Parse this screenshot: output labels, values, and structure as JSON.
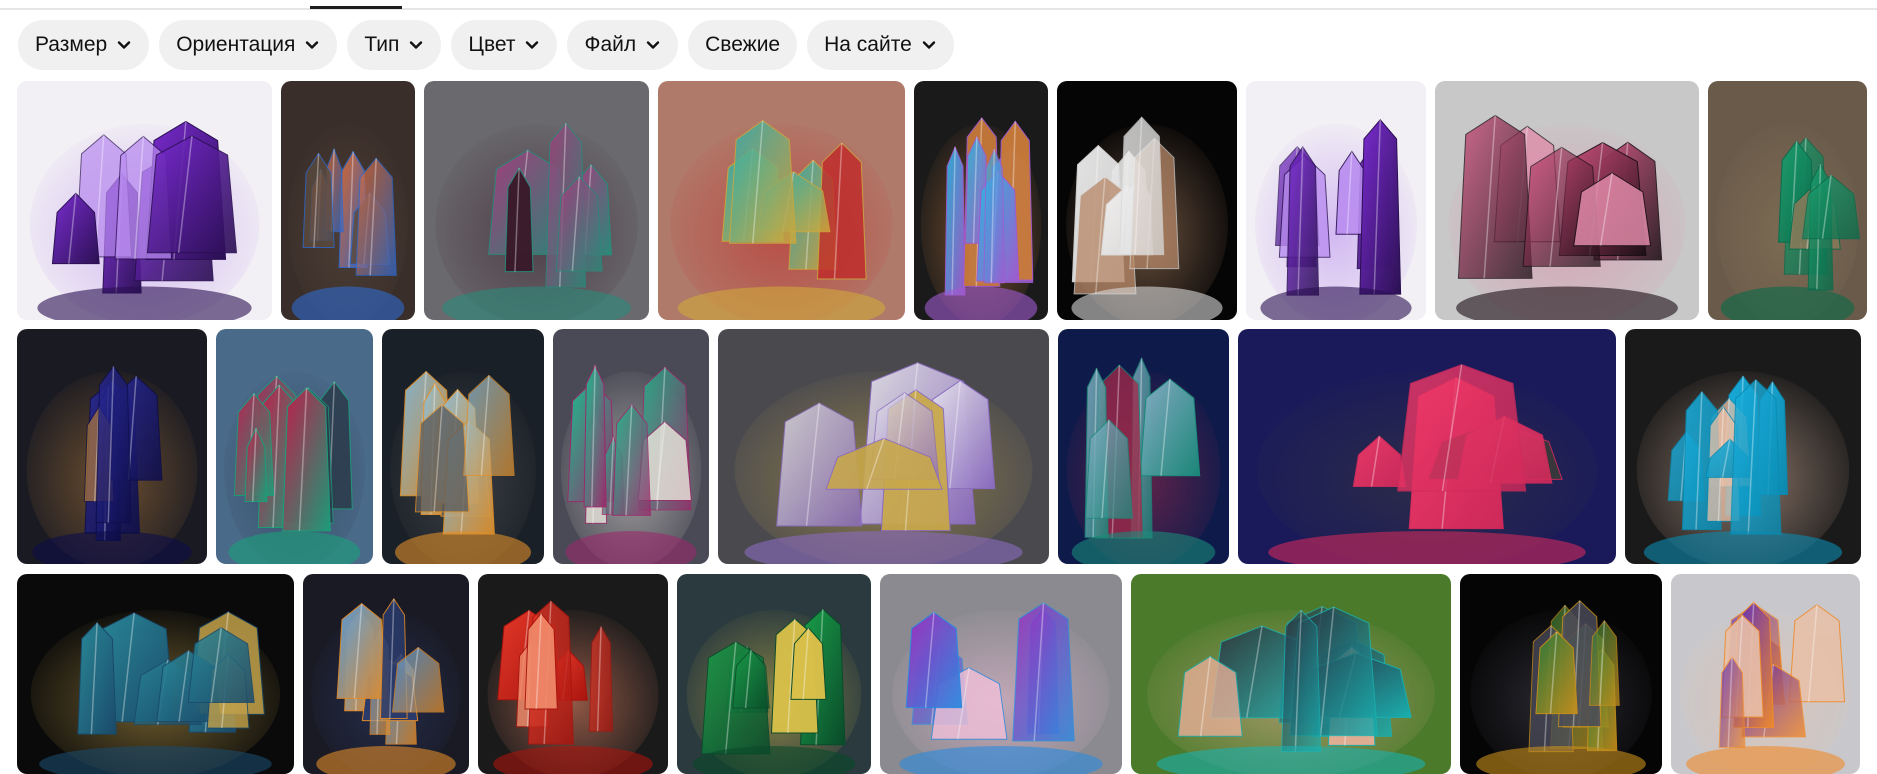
{
  "filters": {
    "size": "Размер",
    "orientation": "Ориентация",
    "type": "Тип",
    "color": "Цвет",
    "file": "Файл",
    "fresh": "Свежие",
    "on_site": "На сайте"
  },
  "gallery": {
    "rows": [
      [
        {
          "name": "purple-fluorite-cube",
          "bg": "#f2f0f4",
          "c1": "#7a2bd1",
          "c2": "#2a0f52",
          "c3": "#b98cf0"
        },
        {
          "name": "rainbow-crystal-on-rock",
          "bg": "#3a2e2a",
          "c1": "#e86a2a",
          "c2": "#2e6ad1",
          "c3": "#5a4a3e"
        },
        {
          "name": "multicolor-tourmaline-block",
          "bg": "#6a6a6e",
          "c1": "#a83a7e",
          "c2": "#2a8a7a",
          "c3": "#3a1a2a"
        },
        {
          "name": "watermelon-tourmaline-slab",
          "bg": "#b07a6a",
          "c1": "#2ab0b0",
          "c2": "#d0a83a",
          "c3": "#c02a2a"
        },
        {
          "name": "blue-geode",
          "bg": "#1a1a1a",
          "c1": "#2ab8e0",
          "c2": "#a05ad0",
          "c3": "#c87a3a"
        },
        {
          "name": "white-needle-cluster-in-hand",
          "bg": "#050505",
          "c1": "#f4f4f4",
          "c2": "#d8d8d8",
          "c3": "#b88a6a"
        },
        {
          "name": "purple-fluorite-cube-repeat",
          "bg": "#f2f0f4",
          "c1": "#7a2bd1",
          "c2": "#2a0f52",
          "c3": "#b98cf0"
        },
        {
          "name": "pink-black-crystal-cluster",
          "bg": "#c8c8c8",
          "c1": "#d04a7a",
          "c2": "#1a0e14",
          "c3": "#e08aa8"
        },
        {
          "name": "green-fluorite-tower",
          "bg": "#6a5a4a",
          "c1": "#1aa070",
          "c2": "#0a6a4a",
          "c3": "#8a7a5a"
        }
      ],
      [
        {
          "name": "dark-blue-azurite",
          "bg": "#1a1a22",
          "c1": "#2a2a9a",
          "c2": "#0e0e4a",
          "c3": "#b07a3a"
        },
        {
          "name": "red-rhodochrosite-on-malachite",
          "bg": "#4a6a8a",
          "c1": "#c81a4a",
          "c2": "#1aa07a",
          "c3": "#2a3a4a"
        },
        {
          "name": "opal-crystal-rock",
          "bg": "#1a2028",
          "c1": "#8ac0e0",
          "c2": "#e0902a",
          "c3": "#5a5a5a"
        },
        {
          "name": "green-fluorite-cube-on-matrix",
          "bg": "#4a4a56",
          "c1": "#1ac090",
          "c2": "#9a2a6a",
          "c3": "#e8e4da"
        },
        {
          "name": "quartz-and-pyrite-cluster",
          "bg": "#4a4a4e",
          "c1": "#e8e8ec",
          "c2": "#8a6ac0",
          "c3": "#c8a84a"
        },
        {
          "name": "quartz-point-green-phantom",
          "bg": "#0e1a4a",
          "c1": "#8ab0c8",
          "c2": "#1a8a7a",
          "c3": "#a02a4a"
        },
        {
          "name": "red-rhodochrosite-cluster",
          "bg": "#1a1a5a",
          "c1": "#f03a6a",
          "c2": "#d02a5a",
          "c3": "#3a3a3a"
        },
        {
          "name": "blue-crystal-cluster-in-hand",
          "bg": "#1a1a1a",
          "c1": "#1ab0e0",
          "c2": "#0a8ab0",
          "c3": "#e8c0a8"
        }
      ],
      [
        {
          "name": "green-blue-fluorite-cluster",
          "bg": "#0a0a0a",
          "c1": "#2a8a9a",
          "c2": "#1a4a6a",
          "c3": "#c0a04a"
        },
        {
          "name": "blue-opal-stone",
          "bg": "#1a1a24",
          "c1": "#5aa0e0",
          "c2": "#e08a2a",
          "c3": "#2a3a6a"
        },
        {
          "name": "red-crystal-cluster",
          "bg": "#1a1a1a",
          "c1": "#e83a2a",
          "c2": "#a8140e",
          "c3": "#f08a6a"
        },
        {
          "name": "green-crystal-on-yellow-base",
          "bg": "#2a3a3e",
          "c1": "#1aa04a",
          "c2": "#0a4a2a",
          "c3": "#d8c04a"
        },
        {
          "name": "rainbow-druzy-geode",
          "bg": "#8a8a90",
          "c1": "#a02ac0",
          "c2": "#2a8ae0",
          "c3": "#f0c0d8"
        },
        {
          "name": "iridescent-crystal-in-hand",
          "bg": "#4a7a2a",
          "c1": "#2a2a3a",
          "c2": "#1ab0b0",
          "c3": "#e8b098"
        },
        {
          "name": "multicolor-crystal-point",
          "bg": "#050505",
          "c1": "#2a7a3a",
          "c2": "#c8901a",
          "c3": "#4a4a5a"
        },
        {
          "name": "purple-orange-crystal-cluster",
          "bg": "#c8c8cc",
          "c1": "#5a2ac0",
          "c2": "#f08a2a",
          "c3": "#e8c0a8"
        }
      ]
    ]
  }
}
